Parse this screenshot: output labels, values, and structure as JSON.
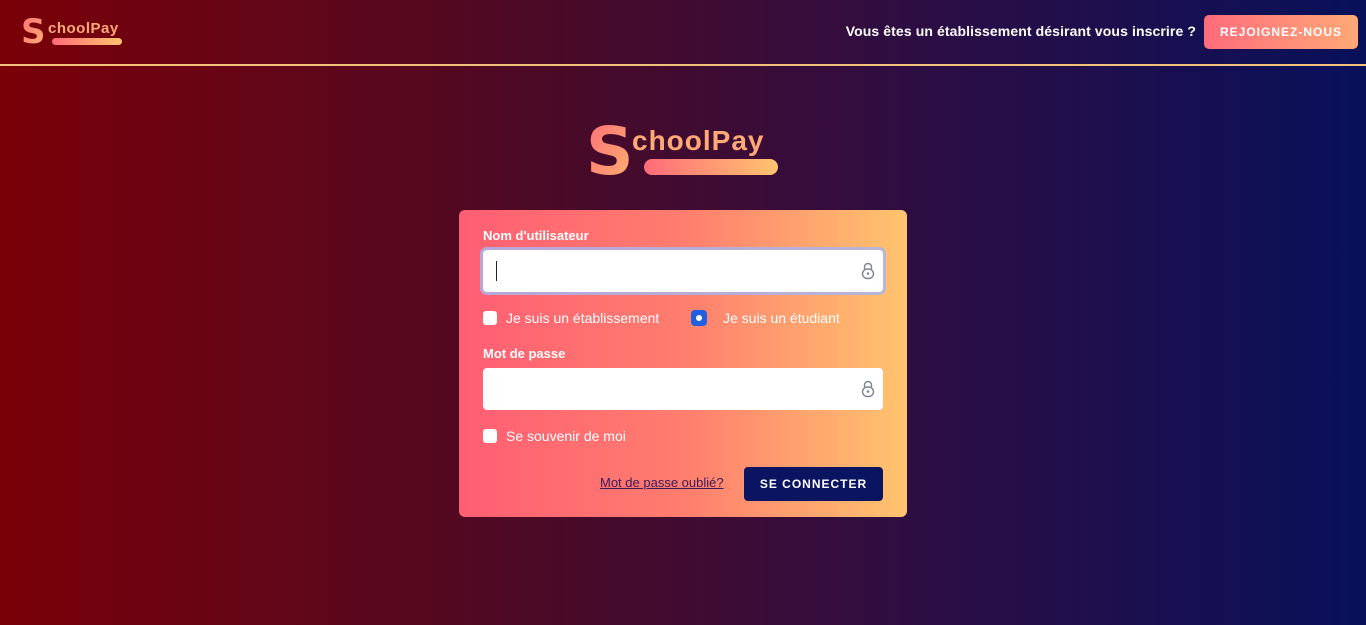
{
  "brand": {
    "initial": "S",
    "rest": "choolPay",
    "colors": {
      "gradient_start": "#ff6b7a",
      "gradient_end": "#ffc46e"
    }
  },
  "header": {
    "prompt": "Vous êtes un établissement désirant vous inscrire ?",
    "join_button": "REJOIGNEZ-NOUS"
  },
  "form": {
    "username_label": "Nom d'utilisateur",
    "username_value": "",
    "role_options": [
      {
        "label": "Je suis un établissement",
        "checked": false
      },
      {
        "label": "Je suis un étudiant",
        "checked": true
      }
    ],
    "password_label": "Mot de passe",
    "password_value": "",
    "remember_label": "Se souvenir de moi",
    "remember_checked": false,
    "forgot_link": "Mot de passe oublié?",
    "submit_button": "SE CONNECTER"
  },
  "icons": {
    "field_icon": "lock-icon"
  }
}
